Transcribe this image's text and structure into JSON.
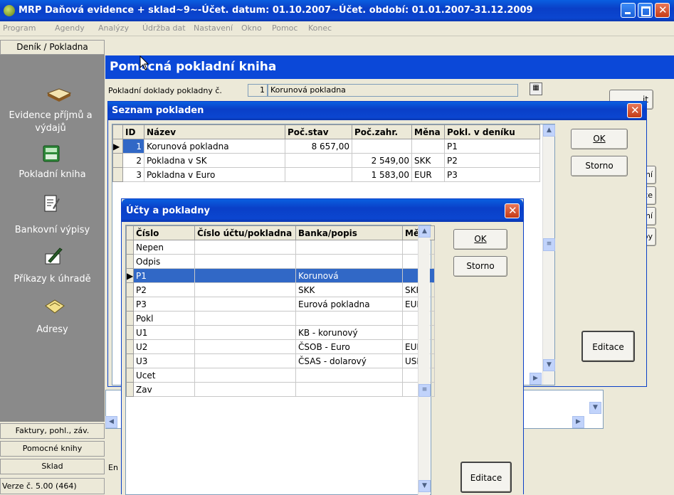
{
  "window": {
    "title": "MRP Daňová evidence + sklad~9~-Účet. datum: 01.10.2007~Účet. období: 01.01.2007-31.12.2009"
  },
  "menu": [
    "Program",
    "Agendy",
    "Analýzy",
    "Údržba dat",
    "Nastavení",
    "Okno",
    "Pomoc",
    "Konec"
  ],
  "sidebar": {
    "top_tab": "Deník / Pokladna",
    "items": [
      {
        "label": "Evidence příjmů a výdajů",
        "icon": "book-icon"
      },
      {
        "label": "Pokladní kniha",
        "icon": "cash-register-icon"
      },
      {
        "label": "Bankovní výpisy",
        "icon": "document-icon"
      },
      {
        "label": "Příkazy k úhradě",
        "icon": "pen-paper-icon"
      },
      {
        "label": "Adresy",
        "icon": "envelope-icon"
      }
    ],
    "bottom_tabs": [
      "Faktury, pohl., záv.",
      "Pomocné knihy",
      "Sklad"
    ]
  },
  "status": {
    "version": "Verze č. 5.00 (464)"
  },
  "main": {
    "header": "Pomocná pokladní kniha",
    "doc_label": "Pokladní doklady pokladny č.",
    "doc_number": "1",
    "doc_name": "Korunová pokladna",
    "bottom_partial": "En",
    "right_button_partial": "it",
    "right_partial_items": [
      "ní",
      "ce",
      "ení",
      "by"
    ]
  },
  "seznam": {
    "title": "Seznam pokladen",
    "columns": [
      "ID",
      "Název",
      "Poč.stav",
      "Poč.zahr.",
      "Měna",
      "Pokl. v deníku"
    ],
    "rows": [
      [
        "1",
        "Korunová pokladna",
        "8 657,00",
        "",
        "",
        "P1"
      ],
      [
        "2",
        "Pokladna v SK",
        "",
        "2 549,00",
        "SKK",
        "P2"
      ],
      [
        "3",
        "Pokladna v Euro",
        "",
        "1 583,00",
        "EUR",
        "P3"
      ]
    ],
    "ok": "OK",
    "storno": "Storno",
    "editace": "Editace"
  },
  "ucty": {
    "title": "Účty a pokladny",
    "columns": [
      "Číslo",
      "Číslo účtu/pokladna",
      "Banka/popis",
      "Měna"
    ],
    "rows": [
      [
        "Nepen",
        "",
        "",
        ""
      ],
      [
        "Odpis",
        "",
        "",
        ""
      ],
      [
        "P1",
        "",
        "Korunová",
        ""
      ],
      [
        "P2",
        "",
        "SKK",
        "SKK"
      ],
      [
        "P3",
        "",
        "Eurová pokladna",
        "EUR"
      ],
      [
        "Pokl",
        "",
        "",
        ""
      ],
      [
        "U1",
        "",
        "KB - korunový",
        ""
      ],
      [
        "U2",
        "",
        "ČSOB - Euro",
        "EUR"
      ],
      [
        "U3",
        "",
        "ČSAS - dolarový",
        "USD"
      ],
      [
        "Ucet",
        "",
        "",
        ""
      ],
      [
        "Zav",
        "",
        "",
        ""
      ]
    ],
    "selected_row": 2,
    "ok": "OK",
    "storno": "Storno",
    "editace": "Editace"
  }
}
